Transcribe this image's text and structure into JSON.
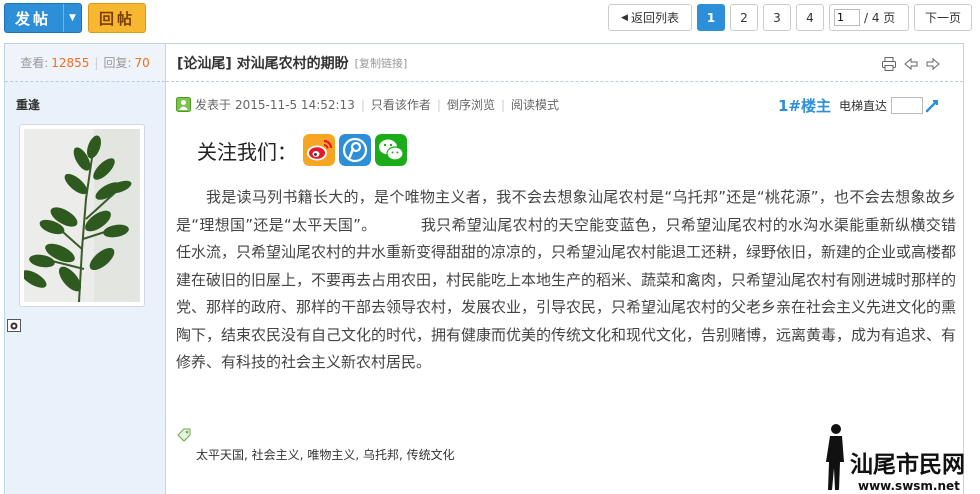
{
  "toolbar": {
    "post_label": "发帖",
    "reply_label": "回帖"
  },
  "pager": {
    "back_label": "返回列表",
    "pages": [
      "1",
      "2",
      "3",
      "4"
    ],
    "current_page": "1",
    "jump_value": "1",
    "total_label": "/ 4 页",
    "next_label": "下一页"
  },
  "stats": {
    "views_label": "查看:",
    "views": "12855",
    "replies_label": "回复:",
    "replies": "70"
  },
  "author": {
    "name": "重逢"
  },
  "post": {
    "title": "[论汕尾] 对汕尾农村的期盼",
    "copy_link": "[复制链接]",
    "meta": {
      "posted_prefix": "发表于",
      "datetime": "2015-11-5 14:52:13",
      "only_author": "只看该作者",
      "reverse": "倒序浏览",
      "read_mode": "阅读模式"
    },
    "floor": "1#楼主",
    "elevator_label": "电梯直达",
    "follow_label": "关注我们：",
    "content_part1": "我是读马列书籍长大的，是个唯物主义者，我不会去想象汕尾农村是“乌托邦”还是“桃花源”，也不会去想象故乡是“理想国”还是“太平天国”。",
    "content_part2": "我只希望汕尾农村的天空能变蓝色，只希望汕尾农村的水沟水渠能重新纵横交错任水流，只希望汕尾农村的井水重新变得甜甜的凉凉的，只希望汕尾农村能退工还耕，绿野依旧，新建的企业或高楼都建在破旧的旧屋上，不要再去占用农田，村民能吃上本地生产的稻米、蔬菜和禽肉，只希望汕尾农村有刚进城时那样的党、那样的政府、那样的干部去领导农村，发展农业，引导农民，只希望汕尾农村的父老乡亲在社会主义先进文化的熏陶下，结束农民没有自己文化的时代，拥有健康而优美的传统文化和现代文化，告别赌博，远离黄毒，成为有追求、有修养、有科技的社会主义新农村居民。",
    "tags": [
      "太平天国",
      "社会主义",
      "唯物主义",
      "乌托邦",
      "传统文化"
    ]
  },
  "watermark": {
    "name": "汕尾市民网",
    "url": "www.swsm.net"
  },
  "colors": {
    "accent_blue": "#2e8fd9",
    "reply_yellow": "#f7b731",
    "count_orange": "#f26c23",
    "sidebar_bg": "#e9f2fb"
  }
}
